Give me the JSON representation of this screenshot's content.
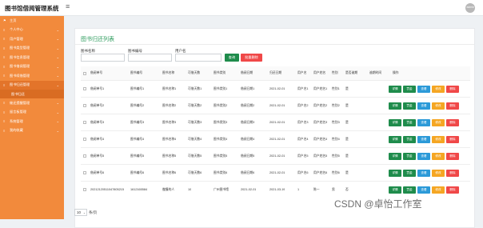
{
  "app": {
    "title": "图书馆借阅管理系统",
    "avatar_text": "admin"
  },
  "sidebar": {
    "items": [
      {
        "icon": "⚑",
        "label": "主页",
        "arrow": "",
        "active": false
      },
      {
        "icon": "≡",
        "label": "个人中心",
        "arrow": "⌄",
        "active": false
      },
      {
        "icon": "≡",
        "label": "用户管理",
        "arrow": "⌄",
        "active": false
      },
      {
        "icon": "≡",
        "label": "图书类型管理",
        "arrow": "⌄",
        "active": false
      },
      {
        "icon": "≡",
        "label": "图书信息管理",
        "arrow": "⌄",
        "active": false
      },
      {
        "icon": "≡",
        "label": "图书借阅管理",
        "arrow": "⌄",
        "active": false
      },
      {
        "icon": "≡",
        "label": "图书续借管理",
        "arrow": "⌄",
        "active": false
      },
      {
        "icon": "≡",
        "label": "图书归还管理",
        "arrow": "⌄",
        "active": true
      }
    ],
    "sub_item": "图书归还",
    "items_after": [
      {
        "icon": "≡",
        "label": "催还提醒管理",
        "arrow": "⌄"
      },
      {
        "icon": "≡",
        "label": "留言板管理",
        "arrow": "⌄"
      },
      {
        "icon": "≡",
        "label": "系统管理",
        "arrow": "⌄"
      },
      {
        "icon": "≡",
        "label": "我的收藏",
        "arrow": "⌄"
      }
    ]
  },
  "page": {
    "title": "图书归还列表"
  },
  "filters": {
    "book_name_label": "图书名称",
    "book_no_label": "图书编号",
    "user_label": "用户名",
    "search_label": "查询",
    "batch_delete_label": "批量删除"
  },
  "table": {
    "headers": [
      "借阅单号",
      "图书编号",
      "图书名称",
      "可借天数",
      "图书类别",
      "借阅日期",
      "归还日期",
      "用户名",
      "用户姓名",
      "性别",
      "是否逾期",
      "逾期时间",
      "操作"
    ],
    "rows": [
      [
        "借阅单号1",
        "图书编号1",
        "图书名称1",
        "可借天数1",
        "图书类别1",
        "借阅日期1",
        "2021-02-01",
        "用户名1",
        "用户姓名1",
        "性别1",
        "是",
        "",
        ""
      ],
      [
        "借阅单号2",
        "图书编号2",
        "图书名称2",
        "可借天数2",
        "图书类别2",
        "借阅日期2",
        "2021-02-01",
        "用户名2",
        "用户姓名2",
        "性别2",
        "是",
        "",
        ""
      ],
      [
        "借阅单号3",
        "图书编号3",
        "图书名称3",
        "可借天数3",
        "图书类别3",
        "借阅日期3",
        "2021-02-01",
        "用户名3",
        "用户姓名3",
        "性别3",
        "是",
        "",
        ""
      ],
      [
        "借阅单号4",
        "图书编号4",
        "图书名称4",
        "可借天数4",
        "图书类别4",
        "借阅日期4",
        "2021-02-01",
        "用户名4",
        "用户姓名4",
        "性别4",
        "是",
        "",
        ""
      ],
      [
        "借阅单号5",
        "图书编号5",
        "图书名称5",
        "可借天数5",
        "图书类别5",
        "借阅日期5",
        "2021-02-01",
        "用户名5",
        "用户姓名5",
        "性别5",
        "是",
        "",
        ""
      ],
      [
        "借阅单号6",
        "图书编号6",
        "图书名称6",
        "可借天数6",
        "图书类别6",
        "借阅日期6",
        "2021-02-01",
        "用户名6",
        "用户姓名6",
        "性别6",
        "是",
        "",
        ""
      ],
      [
        "20212120511047805215",
        "1612165584",
        "傲慢的人",
        "10",
        "广州图书馆",
        "2021-02-01",
        "2021-03-19",
        "1",
        "陈一",
        "男",
        "否",
        "",
        ""
      ]
    ],
    "actions": [
      "详情",
      "罚金",
      "查看",
      "修改",
      "删除"
    ]
  },
  "pager": {
    "page_size": "10",
    "suffix": "条/页"
  },
  "watermark": "CSDN @卓怡工作室",
  "colors": {
    "sidebar": "#f28a3c",
    "primary": "#1f8c4c",
    "danger": "#f04848",
    "info": "#2c9ad8",
    "warning": "#f5a623"
  }
}
